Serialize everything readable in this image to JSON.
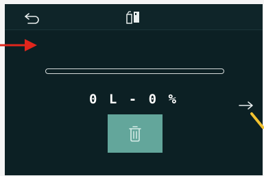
{
  "topbar": {
    "back_icon": "back-arrow-icon",
    "center_icon": "tank-swap-icon"
  },
  "progress": {
    "value_percent": 0
  },
  "readout": {
    "text": "0 L - 0 %"
  },
  "actions": {
    "delete_icon": "trash-icon",
    "next_icon": "arrow-right-icon"
  },
  "colors": {
    "background": "#0c2024",
    "topbar": "#0f2529",
    "button": "#63a69b",
    "annotation_red": "#e1261c",
    "annotation_yellow": "#f2c230"
  }
}
